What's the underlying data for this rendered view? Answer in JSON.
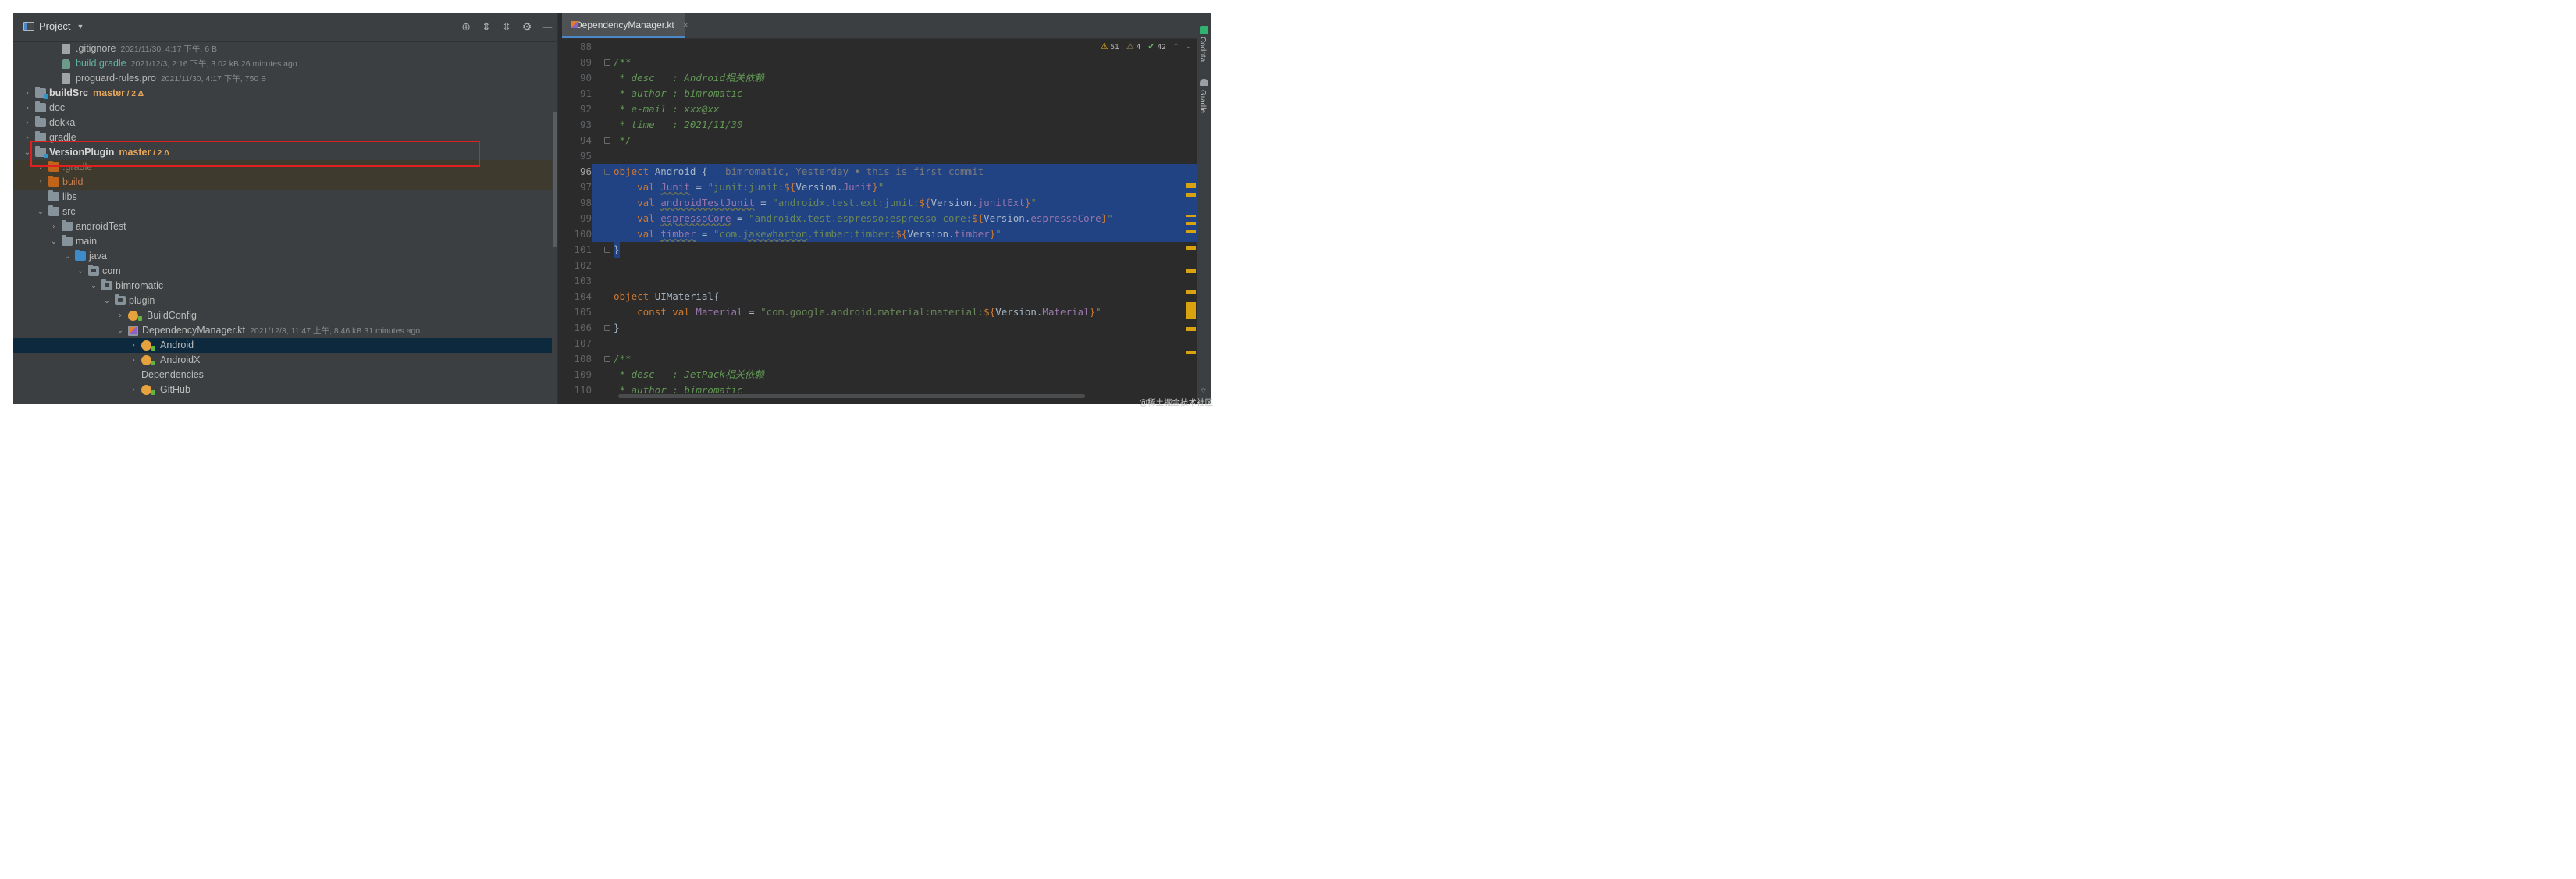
{
  "project_panel": {
    "title": "Project",
    "tool_icons": [
      "locate-icon",
      "expand-all-icon",
      "collapse-all-icon",
      "gear-icon",
      "minimize-icon"
    ],
    "tree": [
      {
        "level": 3,
        "arrow": "",
        "icon": "file",
        "name": ".gitignore",
        "meta": "2021/11/30, 4:17 下午, 6 B",
        "style": "normal"
      },
      {
        "level": 3,
        "arrow": "",
        "icon": "gradle",
        "name": "build.gradle",
        "meta": "2021/12/3, 2:16 下午, 3.02 kB 26 minutes ago",
        "style": "green"
      },
      {
        "level": 3,
        "arrow": "",
        "icon": "file",
        "name": "proguard-rules.pro",
        "meta": "2021/11/30, 4:17 下午, 750 B",
        "style": "normal"
      },
      {
        "level": 1,
        "arrow": "right",
        "icon": "module",
        "name": "buildSrc",
        "vcs": "master",
        "vcs_extra": "/ 2 Δ",
        "style": "bold"
      },
      {
        "level": 1,
        "arrow": "right",
        "icon": "folder",
        "name": "doc",
        "style": "normal"
      },
      {
        "level": 1,
        "arrow": "right",
        "icon": "folder",
        "name": "dokka",
        "style": "normal"
      },
      {
        "level": 1,
        "arrow": "right",
        "icon": "folder",
        "name": "gradle",
        "style": "normal"
      },
      {
        "level": 1,
        "arrow": "down",
        "icon": "module",
        "name": "VersionPlugin",
        "vcs": "master",
        "vcs_extra": "/ 2 Δ",
        "style": "bold"
      },
      {
        "level": 2,
        "arrow": "right",
        "icon": "orange",
        "name": ".gradle",
        "style": "muted",
        "row": "ignored"
      },
      {
        "level": 2,
        "arrow": "right",
        "icon": "orange",
        "name": "build",
        "style": "orange",
        "row": "ignored"
      },
      {
        "level": 2,
        "arrow": "",
        "icon": "folder",
        "name": "libs",
        "style": "normal"
      },
      {
        "level": 2,
        "arrow": "down",
        "icon": "folder",
        "name": "src",
        "style": "normal"
      },
      {
        "level": 3,
        "arrow": "right",
        "icon": "folder",
        "name": "androidTest",
        "style": "normal"
      },
      {
        "level": 3,
        "arrow": "down",
        "icon": "folder",
        "name": "main",
        "style": "normal"
      },
      {
        "level": 4,
        "arrow": "down",
        "icon": "blue",
        "name": "java",
        "style": "normal"
      },
      {
        "level": 5,
        "arrow": "down",
        "icon": "pkg",
        "name": "com",
        "style": "normal"
      },
      {
        "level": 6,
        "arrow": "down",
        "icon": "pkg",
        "name": "bimromatic",
        "style": "normal"
      },
      {
        "level": 7,
        "arrow": "down",
        "icon": "pkg",
        "name": "plugin",
        "style": "normal"
      },
      {
        "level": 8,
        "arrow": "right",
        "icon": "object",
        "name": "BuildConfig",
        "style": "normal"
      },
      {
        "level": 8,
        "arrow": "down",
        "icon": "kotlin",
        "name": "DependencyManager.kt",
        "meta": "2021/12/3, 11:47 上午, 8.46 kB 31 minutes ago",
        "style": "normal"
      },
      {
        "level": 9,
        "arrow": "right",
        "icon": "object",
        "name": "Android",
        "style": "normal",
        "row": "sel"
      },
      {
        "level": 9,
        "arrow": "right",
        "icon": "object",
        "name": "AndroidX",
        "style": "normal"
      },
      {
        "level": 9,
        "arrow": "",
        "icon": "none",
        "name": "Dependencies",
        "style": "normal"
      },
      {
        "level": 9,
        "arrow": "right",
        "icon": "object",
        "name": "GitHub",
        "style": "normal"
      }
    ]
  },
  "editor": {
    "tab": {
      "label": "DependencyManager.kt",
      "close": "×"
    },
    "inspections": {
      "warnings": "51",
      "weak_warnings": "4",
      "ok": "42"
    },
    "lines": [
      {
        "n": "88",
        "segs": []
      },
      {
        "n": "89",
        "fold": true,
        "segs": [
          {
            "c": "c-doc",
            "t": "/**"
          }
        ]
      },
      {
        "n": "90",
        "segs": [
          {
            "c": "c-doc",
            "t": " * desc   : Android相关依赖"
          }
        ]
      },
      {
        "n": "91",
        "segs": [
          {
            "c": "c-doc",
            "t": " * author : "
          },
          {
            "c": "c-doctag",
            "t": "bimromatic"
          }
        ]
      },
      {
        "n": "92",
        "segs": [
          {
            "c": "c-doc",
            "t": " * e-mail : xxx@xx"
          }
        ]
      },
      {
        "n": "93",
        "segs": [
          {
            "c": "c-doc",
            "t": " * time   : 2021/11/30"
          }
        ]
      },
      {
        "n": "94",
        "fold": true,
        "segs": [
          {
            "c": "c-doc",
            "t": " */"
          }
        ]
      },
      {
        "n": "95",
        "segs": []
      },
      {
        "n": "96",
        "fold": true,
        "sel": true,
        "cur": true,
        "segs": [
          {
            "c": "c-kw",
            "t": "object "
          },
          {
            "c": "c-id",
            "t": "Android {"
          },
          {
            "c": "c-blame",
            "t": "   bimromatic, Yesterday • this is first commit"
          }
        ]
      },
      {
        "n": "97",
        "sel": true,
        "segs": [
          {
            "c": "c-kw",
            "t": "    val "
          },
          {
            "c": "c-prop c-under",
            "t": "Junit"
          },
          {
            "c": "c-id",
            "t": " = "
          },
          {
            "c": "c-str",
            "t": "\"junit:junit:"
          },
          {
            "c": "c-tpl",
            "t": "${"
          },
          {
            "c": "c-id",
            "t": "Version."
          },
          {
            "c": "c-prop",
            "t": "Junit"
          },
          {
            "c": "c-tpl",
            "t": "}"
          },
          {
            "c": "c-str",
            "t": "\""
          }
        ]
      },
      {
        "n": "98",
        "sel": true,
        "segs": [
          {
            "c": "c-kw",
            "t": "    val "
          },
          {
            "c": "c-prop c-under",
            "t": "androidTestJunit"
          },
          {
            "c": "c-id",
            "t": " = "
          },
          {
            "c": "c-str",
            "t": "\"androidx.test.ext:junit:"
          },
          {
            "c": "c-tpl",
            "t": "${"
          },
          {
            "c": "c-id",
            "t": "Version."
          },
          {
            "c": "c-prop",
            "t": "junitExt"
          },
          {
            "c": "c-tpl",
            "t": "}"
          },
          {
            "c": "c-str",
            "t": "\""
          }
        ]
      },
      {
        "n": "99",
        "sel": true,
        "segs": [
          {
            "c": "c-kw",
            "t": "    val "
          },
          {
            "c": "c-prop c-under",
            "t": "espressoCore"
          },
          {
            "c": "c-id",
            "t": " = "
          },
          {
            "c": "c-str",
            "t": "\"androidx.test.espresso:espresso-core:"
          },
          {
            "c": "c-tpl",
            "t": "${"
          },
          {
            "c": "c-id",
            "t": "Version."
          },
          {
            "c": "c-prop",
            "t": "espressoCore"
          },
          {
            "c": "c-tpl",
            "t": "}"
          },
          {
            "c": "c-str",
            "t": "\""
          }
        ]
      },
      {
        "n": "100",
        "sel": true,
        "segs": [
          {
            "c": "c-kw",
            "t": "    val "
          },
          {
            "c": "c-prop c-under",
            "t": "timber"
          },
          {
            "c": "c-id",
            "t": " = "
          },
          {
            "c": "c-str",
            "t": "\"com."
          },
          {
            "c": "c-str c-under",
            "t": "jakewharton"
          },
          {
            "c": "c-str",
            "t": ".timber:timber:"
          },
          {
            "c": "c-tpl",
            "t": "${"
          },
          {
            "c": "c-id",
            "t": "Version."
          },
          {
            "c": "c-prop",
            "t": "timber"
          },
          {
            "c": "c-tpl",
            "t": "}"
          },
          {
            "c": "c-str",
            "t": "\""
          }
        ]
      },
      {
        "n": "101",
        "fold": true,
        "segsel": true,
        "segs": [
          {
            "c": "c-id",
            "t": "}"
          }
        ]
      },
      {
        "n": "102",
        "segs": []
      },
      {
        "n": "103",
        "segs": []
      },
      {
        "n": "104",
        "segs": [
          {
            "c": "c-kw",
            "t": "object "
          },
          {
            "c": "c-id",
            "t": "UIMaterial{"
          }
        ]
      },
      {
        "n": "105",
        "segs": [
          {
            "c": "c-kw",
            "t": "    const val "
          },
          {
            "c": "c-prop",
            "t": "Material"
          },
          {
            "c": "c-id",
            "t": " = "
          },
          {
            "c": "c-str",
            "t": "\"com.google.android.material:material:"
          },
          {
            "c": "c-tpl",
            "t": "${"
          },
          {
            "c": "c-id",
            "t": "Version."
          },
          {
            "c": "c-prop",
            "t": "Material"
          },
          {
            "c": "c-tpl",
            "t": "}"
          },
          {
            "c": "c-str",
            "t": "\""
          }
        ]
      },
      {
        "n": "106",
        "fold": true,
        "segs": [
          {
            "c": "c-id",
            "t": "}"
          }
        ]
      },
      {
        "n": "107",
        "segs": []
      },
      {
        "n": "108",
        "fold": true,
        "segs": [
          {
            "c": "c-doc",
            "t": "/**"
          }
        ]
      },
      {
        "n": "109",
        "segs": [
          {
            "c": "c-doc",
            "t": " * desc   : JetPack相关依赖"
          }
        ]
      },
      {
        "n": "110",
        "segs": [
          {
            "c": "c-doc",
            "t": " * author : "
          },
          {
            "c": "c-doctag",
            "t": "bimromatic"
          }
        ]
      }
    ]
  },
  "right_toolbar": {
    "codota": "Codota",
    "gradle": "Gradle"
  },
  "watermark": "@稀土掘金技术社区",
  "colors": {
    "selection": "#214283",
    "highlight_box": "#e02020",
    "vcs_branch": "#e8a75a",
    "string": "#6a8759",
    "keyword": "#cc7832"
  }
}
